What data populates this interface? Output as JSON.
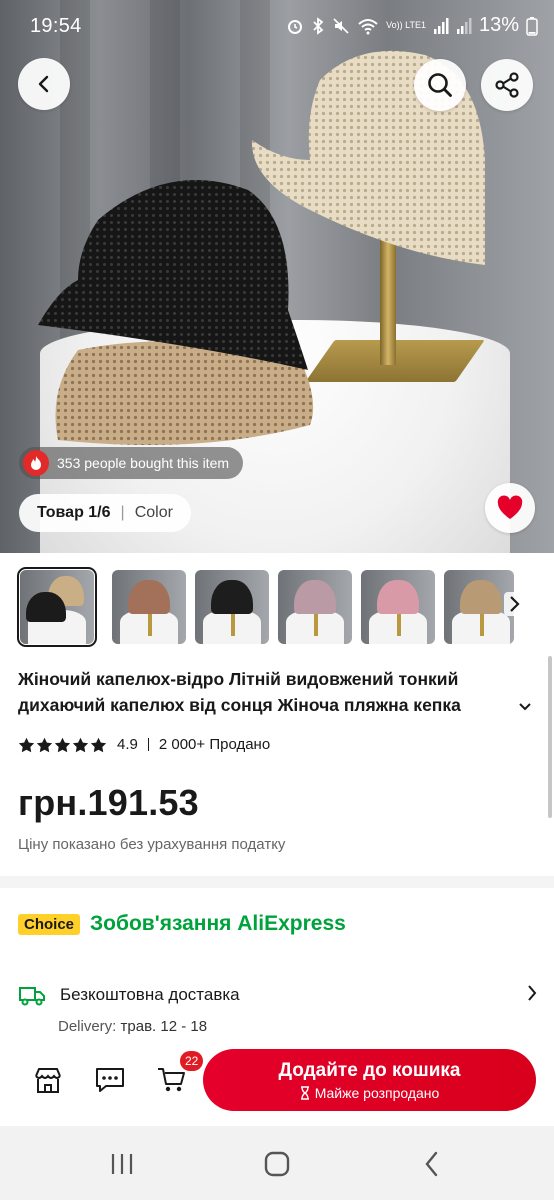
{
  "status_bar": {
    "time": "19:54",
    "network_label": "Vo)) LTE1",
    "battery": "13%"
  },
  "hero": {
    "bought_text": "353 people bought this item",
    "item_counter": "Товар 1/6",
    "color_label": "Color"
  },
  "thumbnails": [
    {
      "hat_color": "#1b1b1b",
      "hat2_color": "#c9ae86"
    },
    {
      "hat_color": "#a3705a"
    },
    {
      "hat_color": "#1d1d1d"
    },
    {
      "hat_color": "#b99aa5"
    },
    {
      "hat_color": "#d99aa8"
    },
    {
      "hat_color": "#b89a75"
    }
  ],
  "product": {
    "title": "Жіночий капелюх-відро Літній видовжений тонкий дихаючий капелюх від сонця Жіноча пляжна кепка",
    "rating": "4.9",
    "sold": "2 000+ Продано",
    "price": "грн.191.53",
    "tax_note": "Ціну показано без урахування податку"
  },
  "choice": {
    "badge": "Choice",
    "text": "Зобов'язання AliExpress"
  },
  "delivery": {
    "title": "Безкоштовна доставка",
    "date_label": "Delivery:",
    "date_value": "трав. 12 - 18"
  },
  "action_bar": {
    "cart_count": "22",
    "add_to_cart": "Додайте до кошика",
    "stock_note": "Майже розпродано"
  },
  "colors": {
    "accent_red": "#e4002b",
    "choice_green": "#00a23c",
    "choice_yellow": "#ffd02a"
  }
}
